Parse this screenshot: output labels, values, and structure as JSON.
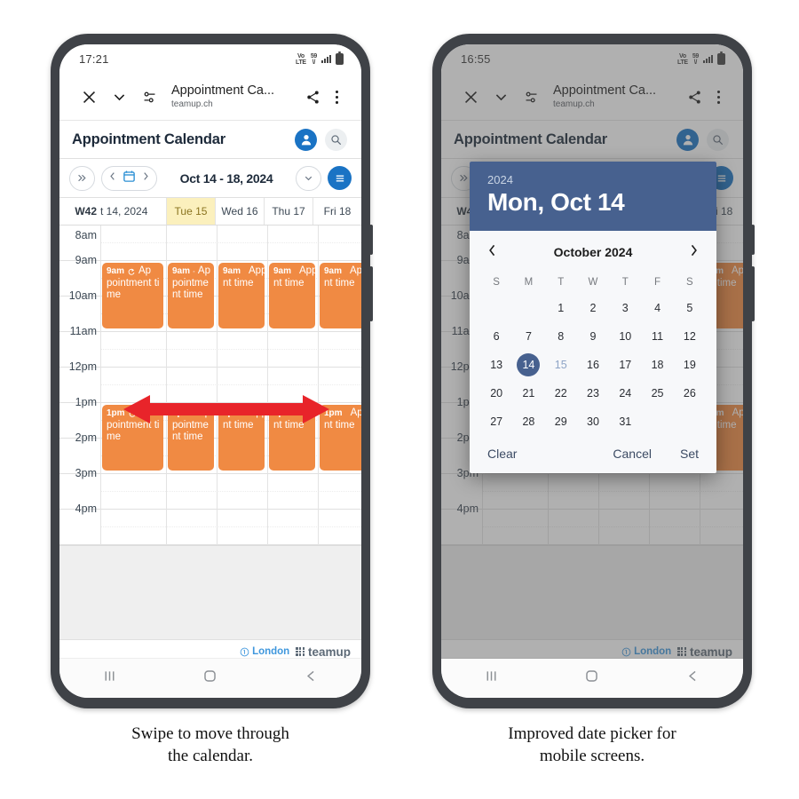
{
  "page": {
    "caption_left": [
      "Swipe to move through",
      "the calendar."
    ],
    "caption_right": [
      "Improved date picker for",
      "mobile screens."
    ]
  },
  "colors": {
    "event_orange": "#f08a43",
    "brand_blue": "#1a73c4",
    "dialog_blue": "#47618f",
    "today_yellow": "#fbf0bd",
    "arrow_red": "#e8242a",
    "london_link": "#3f97dd"
  },
  "phone_left": {
    "status": {
      "time": "17:21",
      "lte_label": "VoLTE",
      "wifi_label": "59"
    },
    "browser": {
      "close_icon": "close-icon",
      "collapse_icon": "chevron-down-icon",
      "tune_icon": "page-settings-icon",
      "title": "Appointment Ca...",
      "url": "teamup.ch",
      "share_icon": "share-icon",
      "overflow_icon": "more-vertical-icon"
    },
    "app_header": {
      "title": "Appointment Calendar",
      "avatar_icon": "user-avatar-icon",
      "search_icon": "search-icon"
    },
    "toolbar": {
      "expand_label": "»",
      "prev_label": "‹",
      "calendar_icon": "calendar-icon",
      "next_label": "›",
      "range": "Oct 14 - 18, 2024",
      "dropdown_icon": "chevron-down-icon",
      "menu_icon": "hamburger-menu-icon"
    },
    "calendar": {
      "week_label": "W42",
      "monday_label": "t 14, 2024",
      "day_headers": [
        "Tue 15",
        "Wed 16",
        "Thu 17",
        "Fri 18"
      ],
      "today_index": 0,
      "hours": [
        "8am",
        "9am",
        "10am",
        "11am",
        "12pm",
        "1pm",
        "2pm",
        "3pm",
        "4pm"
      ],
      "events": [
        {
          "time": "9am",
          "title": "Appointment time",
          "col": 0,
          "start": "9am",
          "icons": [
            "recur-icon"
          ]
        },
        {
          "time": "9am",
          "title": "Appointment time",
          "col": 1,
          "start": "9am",
          "icons": [
            "recur-icon"
          ]
        },
        {
          "time": "9am",
          "title": "Appointment time",
          "col": 2,
          "start": "9am",
          "icons": [
            "flag-icon",
            "recur-icon"
          ]
        },
        {
          "time": "9am",
          "title": "Appointment time",
          "col": 3,
          "start": "9am",
          "icons": [
            "flag-icon",
            "recur-icon"
          ]
        },
        {
          "time": "9am",
          "title": "Appointment time",
          "col": 4,
          "start": "9am",
          "icons": [
            "flag-icon",
            "recur-icon"
          ]
        },
        {
          "time": "1pm",
          "title": "Appointment time",
          "col": 0,
          "start": "1pm",
          "icons": [
            "recur-icon"
          ]
        },
        {
          "time": "1pm",
          "title": "Appointment time",
          "col": 1,
          "start": "1pm",
          "icons": [
            "recur-icon"
          ]
        },
        {
          "time": "1pm",
          "title": "Appointment time",
          "col": 2,
          "start": "1pm",
          "icons": [
            "flag-icon",
            "recur-icon"
          ]
        },
        {
          "time": "1pm",
          "title": "Appointment time",
          "col": 3,
          "start": "1pm",
          "icons": [
            "flag-icon",
            "recur-icon"
          ]
        },
        {
          "time": "1pm",
          "title": "Appointment time",
          "col": 4,
          "start": "1pm",
          "icons": [
            "flag-icon",
            "recur-icon"
          ]
        }
      ],
      "footer": {
        "timezone": "London",
        "brand": "teamup"
      }
    },
    "annotation": {
      "type": "double-arrow",
      "direction": "horizontal"
    },
    "navbar": {
      "recents_icon": "recents-icon",
      "home_icon": "home-icon",
      "back_icon": "back-icon"
    }
  },
  "phone_right": {
    "status": {
      "time": "16:55",
      "lte_label": "VoLTE",
      "wifi_label": "59"
    },
    "browser": {
      "close_icon": "close-icon",
      "collapse_icon": "chevron-down-icon",
      "tune_icon": "page-settings-icon",
      "title": "Appointment Ca...",
      "url": "teamup.ch",
      "share_icon": "share-icon",
      "overflow_icon": "more-vertical-icon"
    },
    "app_header": {
      "title": "Appointment Calendar",
      "avatar_icon": "user-avatar-icon",
      "search_icon": "search-icon"
    },
    "toolbar": {
      "expand_label": "»",
      "menu_icon": "hamburger-menu-icon"
    },
    "calendar": {
      "week_label": "W42",
      "day_header_last": "Fri 18",
      "hours": [
        "8am",
        "9am",
        "10am",
        "11am",
        "12pm",
        "1pm",
        "2pm",
        "3pm",
        "4pm"
      ],
      "footer": {
        "timezone": "London",
        "brand": "teamup"
      }
    },
    "date_picker": {
      "year": "2024",
      "selected_date_label": "Mon, Oct 14",
      "month_label": "October 2024",
      "prev_icon": "chevron-left-icon",
      "next_icon": "chevron-right-icon",
      "weekday_headers": [
        "S",
        "M",
        "T",
        "W",
        "T",
        "F",
        "S"
      ],
      "weeks": [
        [
          "",
          "",
          "1",
          "2",
          "3",
          "4",
          "5"
        ],
        [
          "6",
          "7",
          "8",
          "9",
          "10",
          "11",
          "12"
        ],
        [
          "13",
          "14",
          "15",
          "16",
          "17",
          "18",
          "19"
        ],
        [
          "20",
          "21",
          "22",
          "23",
          "24",
          "25",
          "26"
        ],
        [
          "27",
          "28",
          "29",
          "30",
          "31",
          "",
          ""
        ]
      ],
      "selected_day": "14",
      "highlighted_day": "15",
      "actions": {
        "clear": "Clear",
        "cancel": "Cancel",
        "set": "Set"
      }
    },
    "navbar": {
      "recents_icon": "recents-icon",
      "home_icon": "home-icon",
      "back_icon": "back-icon"
    }
  }
}
